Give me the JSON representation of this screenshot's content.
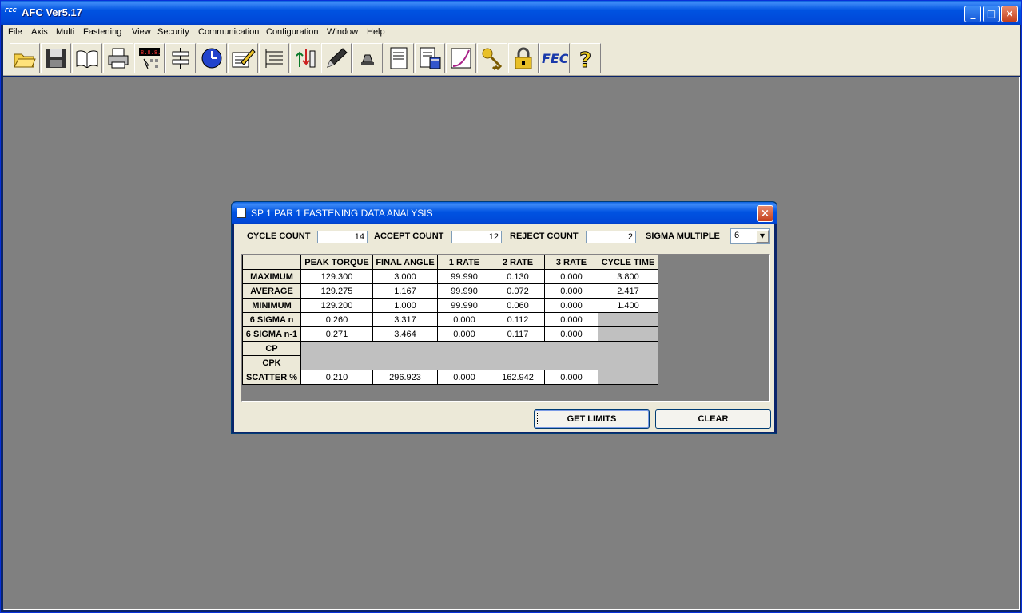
{
  "app": {
    "icon_text": "FEC",
    "title": "AFC Ver5.17",
    "window_buttons": [
      "_",
      "□",
      "×"
    ]
  },
  "menu": [
    {
      "label": "File"
    },
    {
      "label": "Axis"
    },
    {
      "label": "Multi"
    },
    {
      "label": "Fastening"
    },
    {
      "label": "View"
    },
    {
      "label": "Security"
    },
    {
      "label": "Communication"
    },
    {
      "label": "Configuration"
    },
    {
      "label": "Window"
    },
    {
      "label": "Help"
    }
  ],
  "toolbar": [
    "open-folder-icon",
    "save-disk-icon",
    "book-icon",
    "printer-icon",
    "display-counter-icon",
    "flow-diagram-icon",
    "clock-icon",
    "notepad-pencil-icon",
    "list-icon",
    "io-arrows-icon",
    "pen-icon",
    "bell-icon",
    "document-icon",
    "calculator-document-icon",
    "graph-curve-icon",
    "key-icon",
    "lock-icon",
    "fec-logo-icon",
    "help-question-icon"
  ],
  "toolbar_fec_text": "FEC",
  "toolbar_help_text": "?",
  "dialog": {
    "title": "SP 1 PAR 1 FASTENING DATA ANALYSIS",
    "close_glyph": "×",
    "cycle_count_label": "CYCLE COUNT",
    "cycle_count": "14",
    "accept_count_label": "ACCEPT COUNT",
    "accept_count": "12",
    "reject_count_label": "REJECT COUNT",
    "reject_count": "2",
    "sigma_multiple_label": "SIGMA MULTIPLE",
    "sigma_multiple": "6",
    "combo_arrow": "▼",
    "columns": [
      "PEAK TORQUE",
      "FINAL ANGLE",
      "1 RATE",
      "2 RATE",
      "3 RATE",
      "CYCLE TIME"
    ],
    "rows": [
      {
        "label": "MAXIMUM",
        "values": [
          "129.300",
          "3.000",
          "99.990",
          "0.130",
          "0.000",
          "3.800"
        ]
      },
      {
        "label": "AVERAGE",
        "values": [
          "129.275",
          "1.167",
          "99.990",
          "0.072",
          "0.000",
          "2.417"
        ]
      },
      {
        "label": "MINIMUM",
        "values": [
          "129.200",
          "1.000",
          "99.990",
          "0.060",
          "0.000",
          "1.400"
        ]
      },
      {
        "label": "6 SIGMA n",
        "values": [
          "0.260",
          "3.317",
          "0.000",
          "0.112",
          "0.000",
          ""
        ]
      },
      {
        "label": "6 SIGMA n-1",
        "values": [
          "0.271",
          "3.464",
          "0.000",
          "0.117",
          "0.000",
          ""
        ]
      },
      {
        "label": "CP",
        "values": [
          "",
          "",
          "",
          "",
          "",
          ""
        ]
      },
      {
        "label": "CPK",
        "values": [
          "",
          "",
          "",
          "",
          "",
          ""
        ]
      },
      {
        "label": "SCATTER %",
        "values": [
          "0.210",
          "296.923",
          "0.000",
          "162.942",
          "0.000",
          ""
        ]
      }
    ],
    "get_limits_label": "GET LIMITS",
    "clear_label": "CLEAR"
  }
}
